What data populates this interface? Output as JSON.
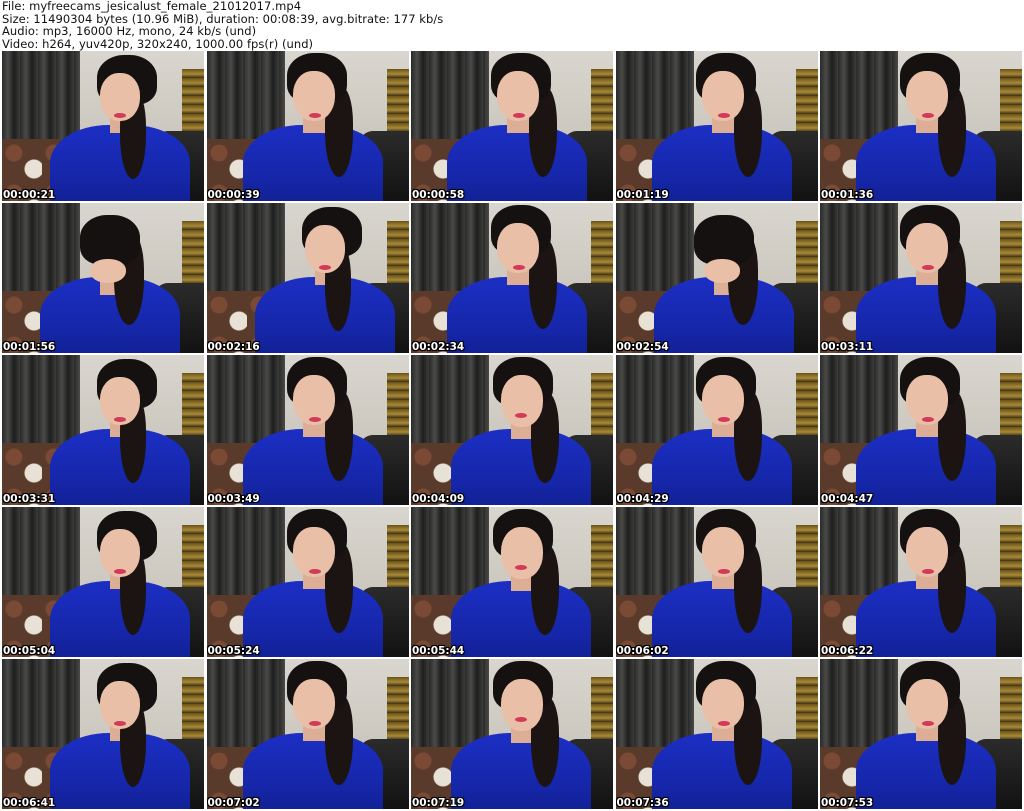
{
  "header": {
    "file_line": "File: myfreecams_jesicalust_female_21012017.mp4",
    "size_line": "Size: 11490304 bytes (10.96 MiB), duration: 00:08:39, avg.bitrate: 177 kb/s",
    "audio_line": "Audio: mp3, 16000 Hz, mono, 24 kb/s (und)",
    "video_line": "Video: h264, yuv420p, 320x240, 1000.00 fps(r) (und)"
  },
  "thumbnails": [
    {
      "timestamp": "00:00:21",
      "pose": "down-left"
    },
    {
      "timestamp": "00:00:39",
      "pose": "down-right"
    },
    {
      "timestamp": "00:00:58",
      "pose": "down-right"
    },
    {
      "timestamp": "00:01:19",
      "pose": "down-right"
    },
    {
      "timestamp": "00:01:36",
      "pose": "down-right"
    },
    {
      "timestamp": "00:01:56",
      "pose": "head-down"
    },
    {
      "timestamp": "00:02:16",
      "pose": "down-left"
    },
    {
      "timestamp": "00:02:34",
      "pose": "down-right"
    },
    {
      "timestamp": "00:02:54",
      "pose": "head-down"
    },
    {
      "timestamp": "00:03:11",
      "pose": "down-right"
    },
    {
      "timestamp": "00:03:31",
      "pose": "down-left"
    },
    {
      "timestamp": "00:03:49",
      "pose": "down-right"
    },
    {
      "timestamp": "00:04:09",
      "pose": "smile"
    },
    {
      "timestamp": "00:04:29",
      "pose": "down-right"
    },
    {
      "timestamp": "00:04:47",
      "pose": "down-right"
    },
    {
      "timestamp": "00:05:04",
      "pose": "down-left"
    },
    {
      "timestamp": "00:05:24",
      "pose": "down-right"
    },
    {
      "timestamp": "00:05:44",
      "pose": "smile"
    },
    {
      "timestamp": "00:06:02",
      "pose": "down-right"
    },
    {
      "timestamp": "00:06:22",
      "pose": "down-right"
    },
    {
      "timestamp": "00:06:41",
      "pose": "down-left"
    },
    {
      "timestamp": "00:07:02",
      "pose": "down-right"
    },
    {
      "timestamp": "00:07:19",
      "pose": "smile"
    },
    {
      "timestamp": "00:07:36",
      "pose": "down-right"
    },
    {
      "timestamp": "00:07:53",
      "pose": "down-right"
    }
  ],
  "colors": {
    "top_blue": "#1c2fc4",
    "lips": "#d23a5a",
    "hair": "#151110",
    "timestamp_text": "#ffffff"
  }
}
